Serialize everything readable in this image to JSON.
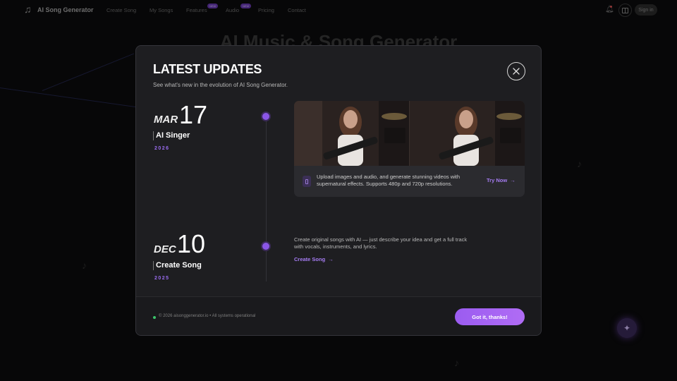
{
  "nav": {
    "brand": "AI Song Generator",
    "links": [
      "Create Song",
      "My Songs",
      "Features",
      "Audio",
      "Pricing",
      "Contact"
    ],
    "badge_new": "NEW",
    "signin": "Sign in"
  },
  "hero": {
    "title": "AI Music & Song Generator"
  },
  "modal": {
    "title": "LATEST UPDATES",
    "subtitle": "See what's new in the evolution of AI Song Generator.",
    "entries": [
      {
        "month": "MAR",
        "day": "17",
        "name": "AI Singer",
        "year": "2026",
        "description": "Upload images and audio, and generate stunning videos with supernatural effects. Supports 480p and 720p resolutions.",
        "link": "Try Now"
      },
      {
        "month": "DEC",
        "day": "10",
        "name": "Create Song",
        "year": "2025",
        "description": "Create original songs with AI — just describe your idea and get a full track with vocals, instruments, and lyrics.",
        "link": "Create Song"
      }
    ],
    "footer_status": "© 2026 aisonggenerator.io • All systems operational",
    "confirm_button": "Got it, thanks!"
  },
  "colors": {
    "accent": "#9b5cf0",
    "link": "#a57cf2",
    "status_ok": "#3cc46a"
  },
  "icons": [
    "music-note-icon",
    "bell-icon",
    "layout-icon",
    "close-icon",
    "video-icon",
    "arrow-right-icon",
    "sparkle-icon"
  ]
}
